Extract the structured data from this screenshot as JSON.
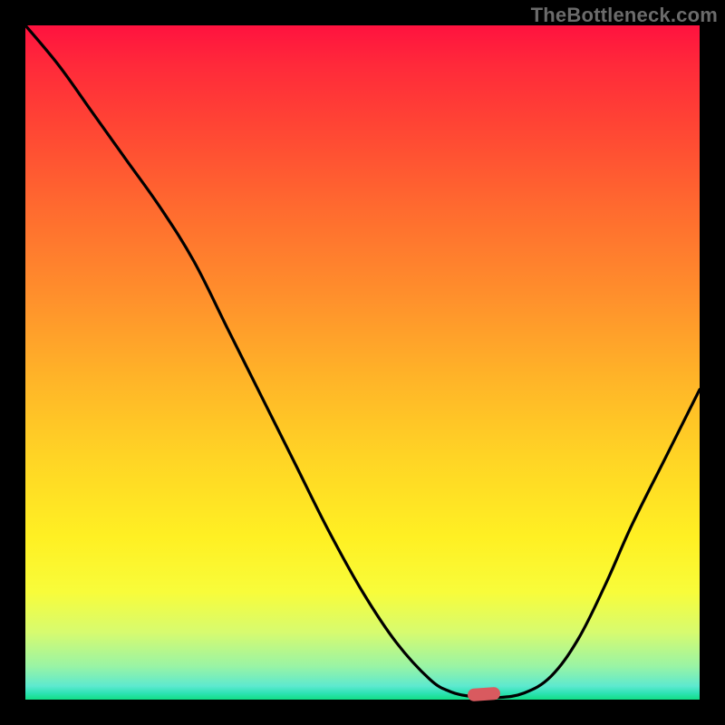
{
  "watermark": "TheBottleneck.com",
  "chart_data": {
    "type": "line",
    "title": "",
    "xlabel": "",
    "ylabel": "",
    "xlim": [
      0,
      1
    ],
    "ylim": [
      0,
      1
    ],
    "series": [
      {
        "name": "bottleneck-curve",
        "x": [
          0.0,
          0.05,
          0.1,
          0.15,
          0.2,
          0.25,
          0.3,
          0.35,
          0.4,
          0.45,
          0.5,
          0.55,
          0.6,
          0.63,
          0.66,
          0.7,
          0.74,
          0.78,
          0.82,
          0.86,
          0.9,
          0.95,
          1.0
        ],
        "y": [
          1.0,
          0.94,
          0.87,
          0.8,
          0.73,
          0.65,
          0.55,
          0.45,
          0.35,
          0.25,
          0.16,
          0.085,
          0.03,
          0.012,
          0.005,
          0.003,
          0.01,
          0.035,
          0.09,
          0.17,
          0.26,
          0.36,
          0.46
        ]
      }
    ],
    "background_gradient": {
      "stops": [
        {
          "pos": 0.0,
          "color": "#ff123f"
        },
        {
          "pos": 0.3,
          "color": "#ff7a2e"
        },
        {
          "pos": 0.6,
          "color": "#ffd325"
        },
        {
          "pos": 0.8,
          "color": "#fff623"
        },
        {
          "pos": 0.93,
          "color": "#c9fa7d"
        },
        {
          "pos": 1.0,
          "color": "#12de85"
        }
      ]
    },
    "marker": {
      "x": 0.68,
      "y": 0.005,
      "color": "#d95a5f"
    }
  }
}
